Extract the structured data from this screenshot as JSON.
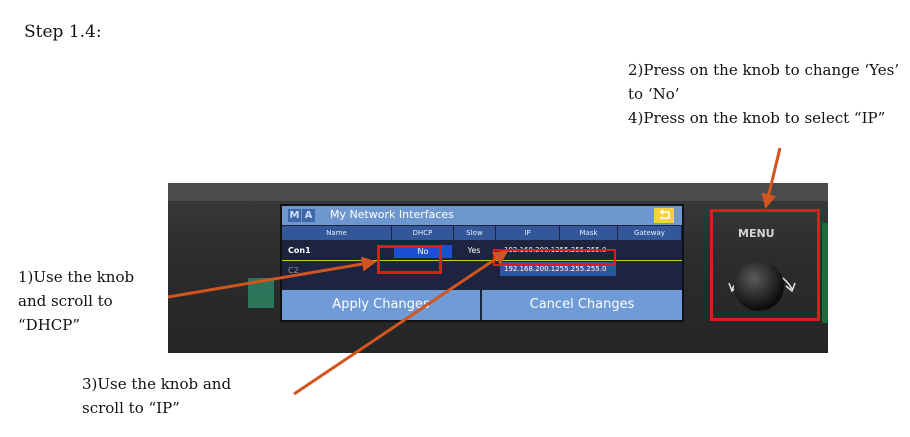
{
  "step": {
    "title": "Step 1.4:"
  },
  "instructions": {
    "right_line1": "2)Press on the knob to change ‘Yes’",
    "right_line2": "to ‘No’",
    "right_line3": "4)Press on the knob to select “IP”",
    "left_line1": "1)Use the knob",
    "left_line2": "and scroll to",
    "left_line3": "“DHCP”",
    "bottom_line1": "3)Use the knob and",
    "bottom_line2": "scroll to “IP”"
  },
  "screen": {
    "logo": [
      "M",
      "A"
    ],
    "title": "My Network Interfaces",
    "columns": [
      "Name",
      "DHCP",
      "Slow",
      "IP",
      "Mask",
      "Gateway"
    ],
    "row": {
      "name": "Con1",
      "dhcp": "No",
      "slow": "Yes",
      "ip_mask": "192.168.200.1255.255.255.0"
    },
    "dropdown_value": "192.168.200.1255.255.255.0",
    "second_row_name": "C2",
    "apply_button": "Apply Changes",
    "cancel_button": "Cancel Changes"
  },
  "device": {
    "menu_label": "MENU"
  },
  "colors": {
    "highlight": "#e01b1b",
    "arrow": "#d2541e",
    "titlebar": "#6f97cf",
    "dhcp_cell": "#1b4fd6",
    "button": "#6f9bd6"
  }
}
